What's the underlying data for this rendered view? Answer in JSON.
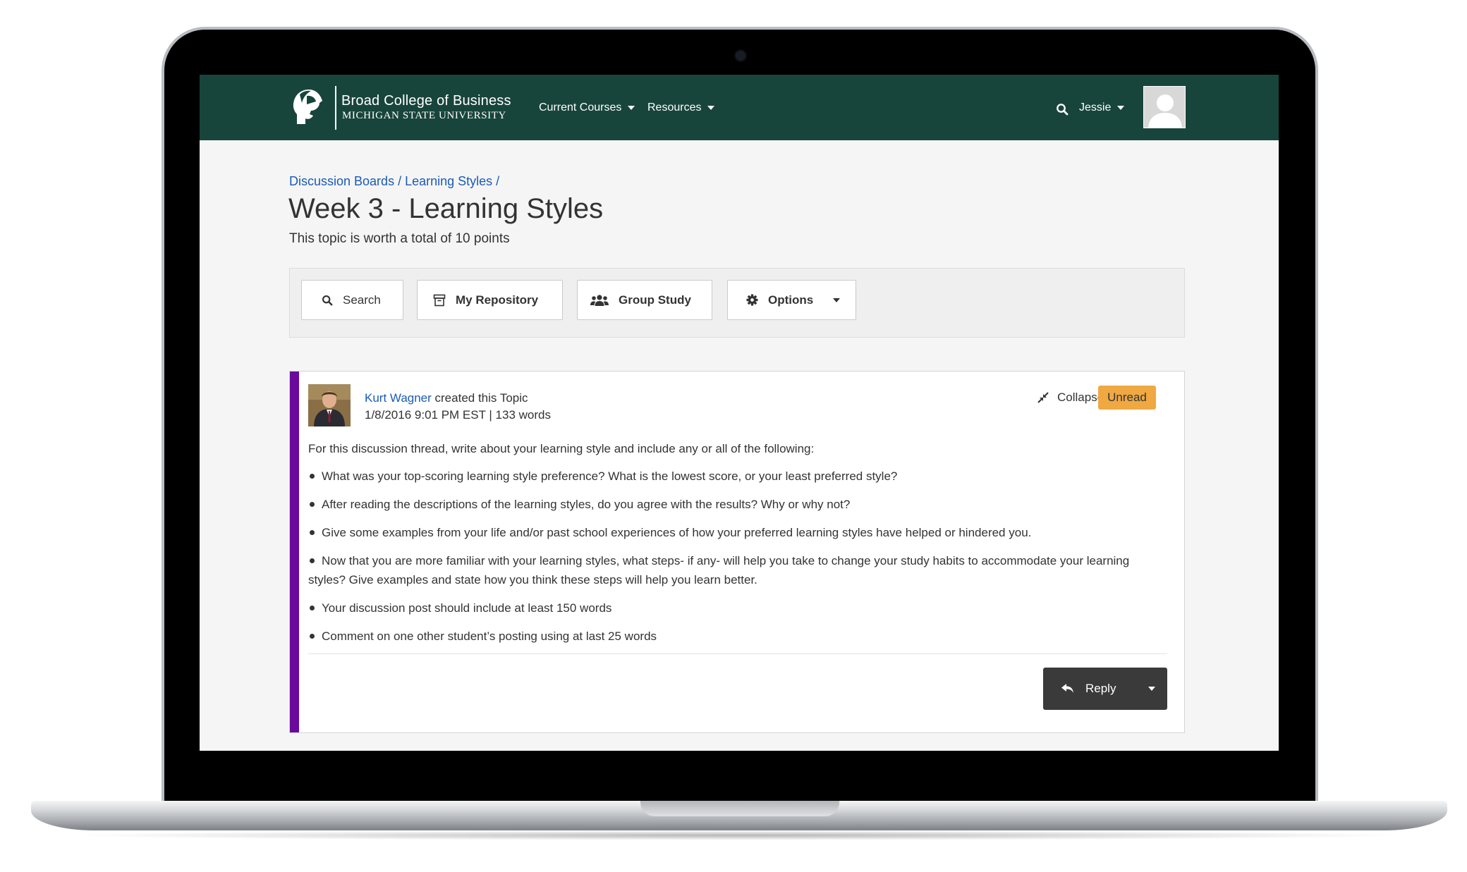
{
  "header": {
    "logo": {
      "line1": "Broad College of Business",
      "line2": "MICHIGAN STATE UNIVERSITY"
    },
    "nav": [
      {
        "label": "Current Courses"
      },
      {
        "label": "Resources"
      }
    ],
    "user": {
      "name": "Jessie"
    }
  },
  "breadcrumb": "Discussion Boards / Learning Styles /",
  "page": {
    "title": "Week 3 - Learning Styles",
    "subtitle": "This topic is worth a total of 10 points"
  },
  "toolbar": {
    "search": "Search",
    "repository": "My Repository",
    "group_study": "Group Study",
    "options": "Options"
  },
  "post": {
    "author": "Kurt Wagner",
    "action": " created this Topic",
    "meta": "1/8/2016 9:01 PM EST | 133 words",
    "collapse": "Collapse",
    "badge": "Unread",
    "intro": "For this discussion thread, write about your learning style and include any or all of the following:",
    "bullets": [
      "What was your top-scoring learning style preference? What is the lowest score, or your least preferred style?",
      "After reading the descriptions of the learning styles, do you agree with the results? Why or why not?",
      "Give some examples from your life and/or past school experiences of how your preferred learning styles have helped or hindered you.",
      "Now that you are more familiar with your learning styles, what steps- if any- will help you take to change your study habits to accommodate your learning styles? Give examples and state how you think these steps will help you learn better.",
      "Your discussion post should include at least 150 words",
      "Comment on one other student’s posting using at last 25 words"
    ],
    "reply": "Reply"
  },
  "colors": {
    "nav_bg": "#18453b",
    "link": "#1a5bb5",
    "accent": "#6a0a9c",
    "badge": "#f0a842",
    "reply_bg": "#3a3a3a"
  }
}
